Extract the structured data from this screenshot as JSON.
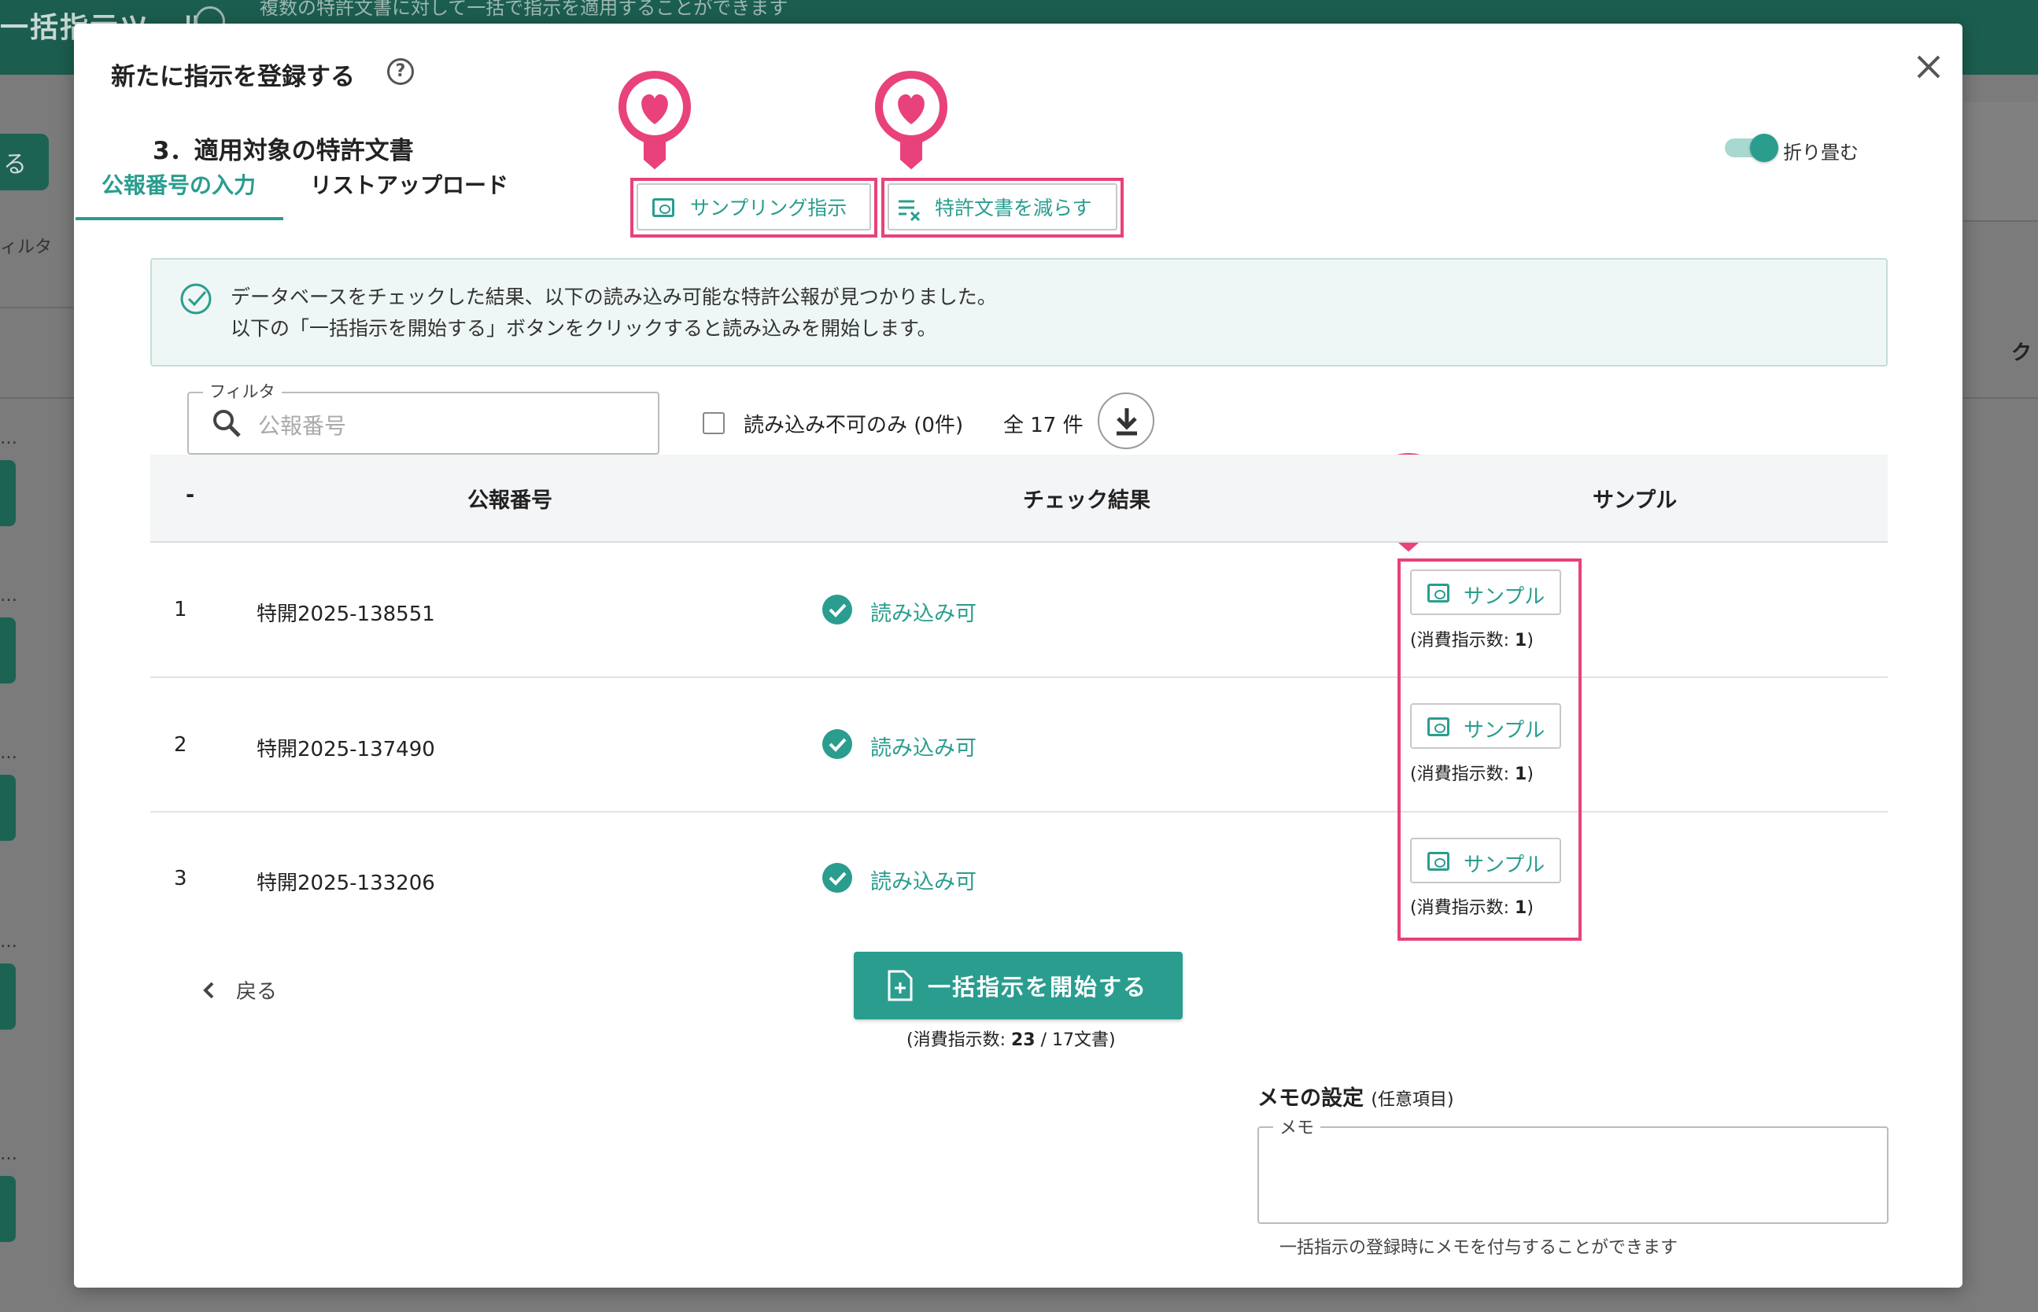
{
  "background": {
    "app_title": "一括指示ツール",
    "app_subtitle": "複数の特許文書に対して一括で指示を適用することができます",
    "left_button_label": "る",
    "left_filter_label": "ィルタ",
    "right_column_letter": "ク"
  },
  "modal": {
    "title": "新たに指示を登録する",
    "section_title": "3．適用対象の特許文書",
    "collapse_toggle_label": "折り畳む",
    "tabs": [
      {
        "label": "公報番号の入力",
        "active": true
      },
      {
        "label": "リストアップロード",
        "active": false
      }
    ],
    "tool_buttons": {
      "sampling": "サンプリング指示",
      "reduce": "特許文書を減らす"
    },
    "info": {
      "line1": "データベースをチェックした結果、以下の読み込み可能な特許公報が見つかりました。",
      "line2": "以下の「一括指示を開始する」ボタンをクリックすると読み込みを開始します。"
    },
    "filter": {
      "legend": "フィルタ",
      "placeholder": "公報番号"
    },
    "unreadable_only_label": "読み込み不可のみ (0件)",
    "total_count": "全 17 件",
    "table": {
      "headers": [
        "-",
        "公報番号",
        "チェック結果",
        "サンプル"
      ],
      "rows": [
        {
          "index": "1",
          "number": "特開2025-138551",
          "status": "読み込み可",
          "sample_label": "サンプル",
          "consume_prefix": "(消費指示数: ",
          "consume_value": "1",
          "consume_suffix": ")"
        },
        {
          "index": "2",
          "number": "特開2025-137490",
          "status": "読み込み可",
          "sample_label": "サンプル",
          "consume_prefix": "(消費指示数: ",
          "consume_value": "1",
          "consume_suffix": ")"
        },
        {
          "index": "3",
          "number": "特開2025-133206",
          "status": "読み込み可",
          "sample_label": "サンプル",
          "consume_prefix": "(消費指示数: ",
          "consume_value": "1",
          "consume_suffix": ")"
        }
      ]
    },
    "back_label": "戻る",
    "start_button": "一括指示を開始する",
    "start_sub": {
      "prefix": "(消費指示数: ",
      "value": "23",
      "suffix": " / 17文書)"
    },
    "memo": {
      "title": "メモの設定",
      "optional": "(任意項目)",
      "legend": "メモ",
      "help": "一括指示の登録時にメモを付与することができます"
    }
  },
  "colors": {
    "accent": "#2a9d8f",
    "highlight": "#e8417c",
    "header_bg": "#1b5e50"
  },
  "icons": [
    "help-icon",
    "close-icon",
    "eye-icon",
    "list-remove-icon",
    "check-circle-icon",
    "search-icon",
    "download-icon",
    "chevron-left-icon",
    "document-add-icon",
    "heart-pin-icon"
  ]
}
